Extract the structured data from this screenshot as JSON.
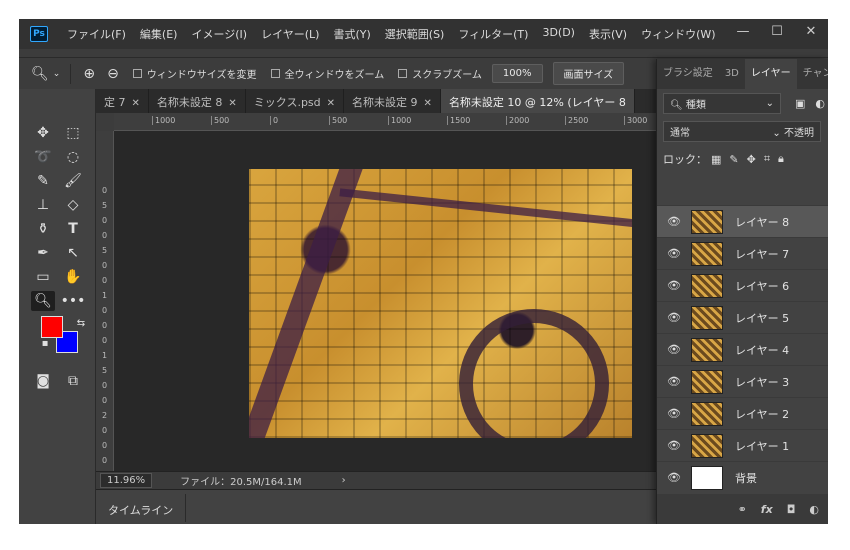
{
  "app": {
    "logo": "Ps"
  },
  "menu": [
    "ファイル(F)",
    "編集(E)",
    "イメージ(I)",
    "レイヤー(L)",
    "書式(Y)",
    "選択範囲(S)",
    "フィルター(T)",
    "3D(D)",
    "表示(V)",
    "ウィンドウ(W)"
  ],
  "window_buttons": {
    "min": "—",
    "max": "☐",
    "close": "✕"
  },
  "options": {
    "resize_windows": "ウィンドウサイズを変更",
    "zoom_all": "全ウィンドウをズーム",
    "scrubby_zoom": "スクラブズーム",
    "zoom_100": "100%",
    "fit_screen": "画面サイズ"
  },
  "tabs": [
    {
      "label": "定 7"
    },
    {
      "label": "名称未設定 8"
    },
    {
      "label": "ミックス.psd"
    },
    {
      "label": "名称未設定 9"
    },
    {
      "label": "名称未設定 10 @ 12% (レイヤー 8"
    }
  ],
  "ruler_top": [
    "1000",
    "500",
    "0",
    "500",
    "1000",
    "1500",
    "2000",
    "2500",
    "3000"
  ],
  "ruler_left": [
    "0",
    "5",
    "0",
    "0",
    "5",
    "0",
    "0",
    "1",
    "0",
    "0",
    "0",
    "1",
    "5",
    "0",
    "0",
    "2",
    "0",
    "0",
    "0"
  ],
  "status": {
    "zoom": "11.96%",
    "file_info": "ファイル：20.5M/164.1M"
  },
  "timeline": {
    "label": "タイムライン"
  },
  "panel": {
    "tabs": [
      "ブラシ設定",
      "3D",
      "レイヤー",
      "チャンネル"
    ],
    "filter_label": "種類",
    "blend_mode": "通常",
    "opacity_label": "不透明",
    "lock_label": "ロック：",
    "layers": [
      "レイヤー 8",
      "レイヤー 7",
      "レイヤー 6",
      "レイヤー 5",
      "レイヤー 4",
      "レイヤー 3",
      "レイヤー 2",
      "レイヤー 1",
      "背景"
    ],
    "selected_layer": "レイヤー 8"
  },
  "colors": {
    "foreground": "#ff0000",
    "background": "#0000ff",
    "accent": "#31a8ff"
  }
}
